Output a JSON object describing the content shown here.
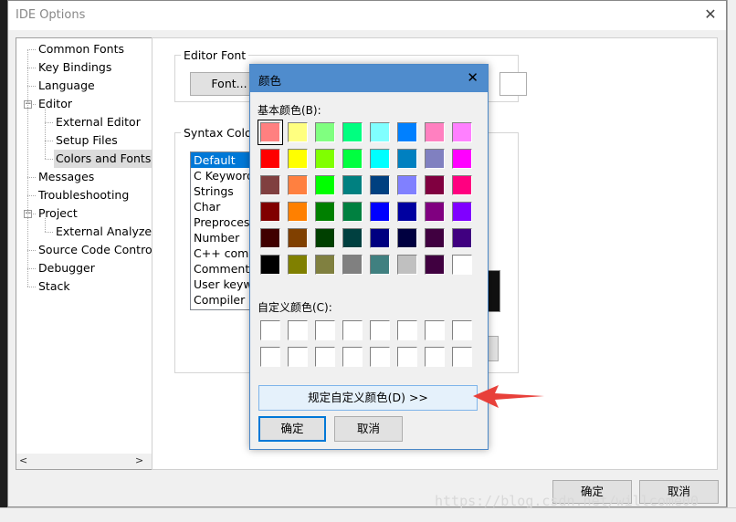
{
  "ide": {
    "title": "IDE Options",
    "close_glyph": "✕",
    "tree": [
      {
        "label": "Common Fonts",
        "depth": 0,
        "expander": ""
      },
      {
        "label": "Key Bindings",
        "depth": 0,
        "expander": ""
      },
      {
        "label": "Language",
        "depth": 0,
        "expander": ""
      },
      {
        "label": "Editor",
        "depth": 0,
        "expander": "−"
      },
      {
        "label": "External Editor",
        "depth": 1,
        "expander": ""
      },
      {
        "label": "Setup Files",
        "depth": 1,
        "expander": ""
      },
      {
        "label": "Colors and Fonts",
        "depth": 1,
        "expander": "",
        "selected": true
      },
      {
        "label": "Messages",
        "depth": 0,
        "expander": ""
      },
      {
        "label": "Troubleshooting",
        "depth": 0,
        "expander": ""
      },
      {
        "label": "Project",
        "depth": 0,
        "expander": "−"
      },
      {
        "label": "External Analyzer",
        "depth": 1,
        "expander": ""
      },
      {
        "label": "Source Code Control",
        "depth": 0,
        "expander": ""
      },
      {
        "label": "Debugger",
        "depth": 0,
        "expander": ""
      },
      {
        "label": "Stack",
        "depth": 0,
        "expander": ""
      }
    ],
    "scroll_left": "<",
    "scroll_right": ">",
    "editor_font_label": "Editor Font",
    "font_button": "Font...",
    "syntax_label": "Syntax Coloring",
    "syntax_items": [
      "Default",
      "C Keywords",
      "Strings",
      "Char",
      "Preprocessor",
      "Number",
      "C++ comment",
      "Comment",
      "User keywords",
      "Compiler keywords"
    ],
    "syntax_selected": 0,
    "ok": "确定",
    "cancel": "取消"
  },
  "color_dialog": {
    "title": "颜色",
    "close_glyph": "✕",
    "basic_label": "基本颜色(B):",
    "custom_label": "自定义颜色(C):",
    "define_button": "规定自定义颜色(D) >>",
    "ok": "确定",
    "cancel": "取消",
    "selected_index": 0,
    "basic_colors": [
      "#ff8080",
      "#ffff80",
      "#80ff80",
      "#00ff80",
      "#80ffff",
      "#0080ff",
      "#ff80c0",
      "#ff80ff",
      "#ff0000",
      "#ffff00",
      "#80ff00",
      "#00ff40",
      "#00ffff",
      "#0080c0",
      "#8080c0",
      "#ff00ff",
      "#804040",
      "#ff8040",
      "#00ff00",
      "#008080",
      "#004080",
      "#8080ff",
      "#800040",
      "#ff0080",
      "#800000",
      "#ff8000",
      "#008000",
      "#008040",
      "#0000ff",
      "#0000a0",
      "#800080",
      "#8000ff",
      "#400000",
      "#804000",
      "#004000",
      "#004040",
      "#000080",
      "#000040",
      "#400040",
      "#400080",
      "#000000",
      "#808000",
      "#808040",
      "#808080",
      "#408080",
      "#c0c0c0",
      "#400040",
      "#ffffff"
    ],
    "custom_colors": [
      "#ffffff",
      "#ffffff",
      "#ffffff",
      "#ffffff",
      "#ffffff",
      "#ffffff",
      "#ffffff",
      "#ffffff",
      "#ffffff",
      "#ffffff",
      "#ffffff",
      "#ffffff",
      "#ffffff",
      "#ffffff",
      "#ffffff",
      "#ffffff"
    ]
  },
  "annotation": {
    "arrow_color": "#e8403a"
  },
  "watermark": "https://blog.csdn.net/willcome00"
}
